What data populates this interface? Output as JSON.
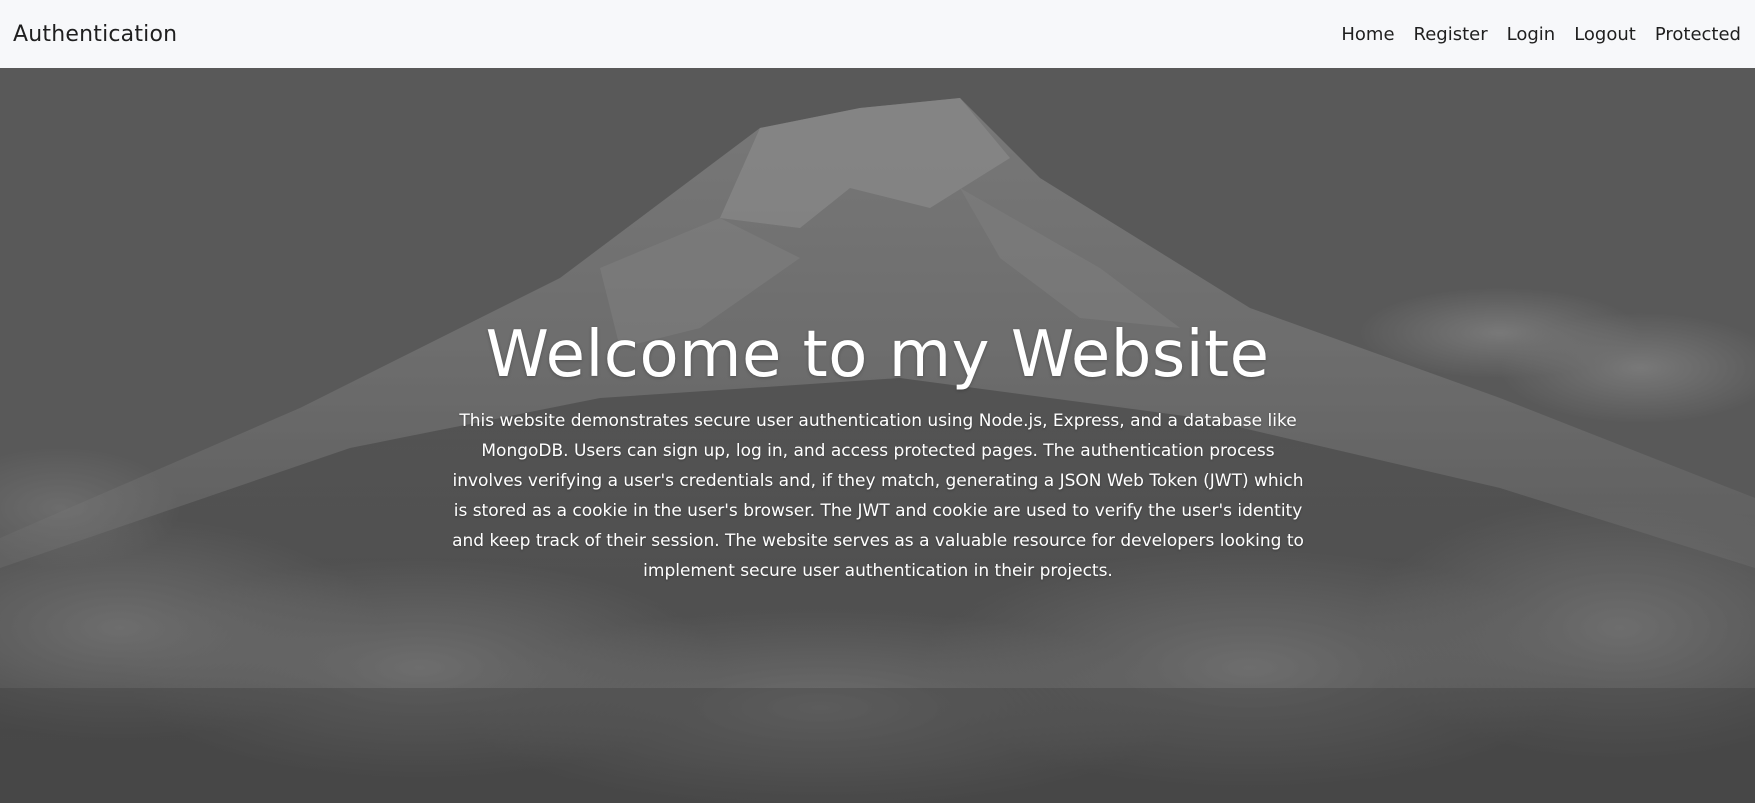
{
  "navbar": {
    "brand": "Authentication",
    "links": [
      "Home",
      "Register",
      "Login",
      "Logout",
      "Protected"
    ]
  },
  "hero": {
    "title": "Welcome to my Website",
    "description": "This website demonstrates secure user authentication using Node.js, Express, and a database like MongoDB. Users can sign up, log in, and access protected pages. The authentication process involves verifying a user's credentials and, if they match, generating a JSON Web Token (JWT) which is stored as a cookie in the user's browser. The JWT and cookie are used to verify the user's identity and keep track of their session. The website serves as a valuable resource for developers looking to implement secure user authentication in their projects.",
    "background": "mountain-clouds-image",
    "overlay_color": "#5c5c5c"
  }
}
